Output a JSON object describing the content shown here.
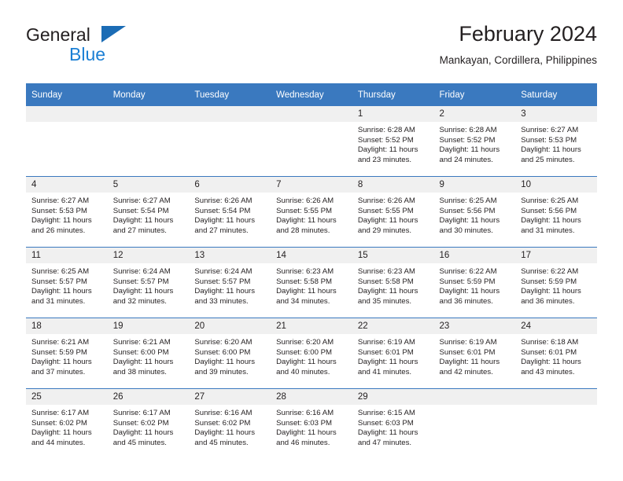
{
  "brand": {
    "name_top": "General",
    "name_bottom": "Blue",
    "triangle_color": "#1b6cb5",
    "blue_color": "#1b7fd4"
  },
  "header": {
    "title": "February 2024",
    "subtitle": "Mankayan, Cordillera, Philippines"
  },
  "theme": {
    "header_bg": "#3a79bf",
    "daynum_bg": "#f0f0f0",
    "row_divider": "#3a79bf",
    "text": "#231f20"
  },
  "weekday_headers": [
    "Sunday",
    "Monday",
    "Tuesday",
    "Wednesday",
    "Thursday",
    "Friday",
    "Saturday"
  ],
  "weeks": [
    [
      {
        "day": "",
        "sunrise": "",
        "sunset": "",
        "daylight_1": "",
        "daylight_2": ""
      },
      {
        "day": "",
        "sunrise": "",
        "sunset": "",
        "daylight_1": "",
        "daylight_2": ""
      },
      {
        "day": "",
        "sunrise": "",
        "sunset": "",
        "daylight_1": "",
        "daylight_2": ""
      },
      {
        "day": "",
        "sunrise": "",
        "sunset": "",
        "daylight_1": "",
        "daylight_2": ""
      },
      {
        "day": "1",
        "sunrise": "Sunrise: 6:28 AM",
        "sunset": "Sunset: 5:52 PM",
        "daylight_1": "Daylight: 11 hours",
        "daylight_2": "and 23 minutes."
      },
      {
        "day": "2",
        "sunrise": "Sunrise: 6:28 AM",
        "sunset": "Sunset: 5:52 PM",
        "daylight_1": "Daylight: 11 hours",
        "daylight_2": "and 24 minutes."
      },
      {
        "day": "3",
        "sunrise": "Sunrise: 6:27 AM",
        "sunset": "Sunset: 5:53 PM",
        "daylight_1": "Daylight: 11 hours",
        "daylight_2": "and 25 minutes."
      }
    ],
    [
      {
        "day": "4",
        "sunrise": "Sunrise: 6:27 AM",
        "sunset": "Sunset: 5:53 PM",
        "daylight_1": "Daylight: 11 hours",
        "daylight_2": "and 26 minutes."
      },
      {
        "day": "5",
        "sunrise": "Sunrise: 6:27 AM",
        "sunset": "Sunset: 5:54 PM",
        "daylight_1": "Daylight: 11 hours",
        "daylight_2": "and 27 minutes."
      },
      {
        "day": "6",
        "sunrise": "Sunrise: 6:26 AM",
        "sunset": "Sunset: 5:54 PM",
        "daylight_1": "Daylight: 11 hours",
        "daylight_2": "and 27 minutes."
      },
      {
        "day": "7",
        "sunrise": "Sunrise: 6:26 AM",
        "sunset": "Sunset: 5:55 PM",
        "daylight_1": "Daylight: 11 hours",
        "daylight_2": "and 28 minutes."
      },
      {
        "day": "8",
        "sunrise": "Sunrise: 6:26 AM",
        "sunset": "Sunset: 5:55 PM",
        "daylight_1": "Daylight: 11 hours",
        "daylight_2": "and 29 minutes."
      },
      {
        "day": "9",
        "sunrise": "Sunrise: 6:25 AM",
        "sunset": "Sunset: 5:56 PM",
        "daylight_1": "Daylight: 11 hours",
        "daylight_2": "and 30 minutes."
      },
      {
        "day": "10",
        "sunrise": "Sunrise: 6:25 AM",
        "sunset": "Sunset: 5:56 PM",
        "daylight_1": "Daylight: 11 hours",
        "daylight_2": "and 31 minutes."
      }
    ],
    [
      {
        "day": "11",
        "sunrise": "Sunrise: 6:25 AM",
        "sunset": "Sunset: 5:57 PM",
        "daylight_1": "Daylight: 11 hours",
        "daylight_2": "and 31 minutes."
      },
      {
        "day": "12",
        "sunrise": "Sunrise: 6:24 AM",
        "sunset": "Sunset: 5:57 PM",
        "daylight_1": "Daylight: 11 hours",
        "daylight_2": "and 32 minutes."
      },
      {
        "day": "13",
        "sunrise": "Sunrise: 6:24 AM",
        "sunset": "Sunset: 5:57 PM",
        "daylight_1": "Daylight: 11 hours",
        "daylight_2": "and 33 minutes."
      },
      {
        "day": "14",
        "sunrise": "Sunrise: 6:23 AM",
        "sunset": "Sunset: 5:58 PM",
        "daylight_1": "Daylight: 11 hours",
        "daylight_2": "and 34 minutes."
      },
      {
        "day": "15",
        "sunrise": "Sunrise: 6:23 AM",
        "sunset": "Sunset: 5:58 PM",
        "daylight_1": "Daylight: 11 hours",
        "daylight_2": "and 35 minutes."
      },
      {
        "day": "16",
        "sunrise": "Sunrise: 6:22 AM",
        "sunset": "Sunset: 5:59 PM",
        "daylight_1": "Daylight: 11 hours",
        "daylight_2": "and 36 minutes."
      },
      {
        "day": "17",
        "sunrise": "Sunrise: 6:22 AM",
        "sunset": "Sunset: 5:59 PM",
        "daylight_1": "Daylight: 11 hours",
        "daylight_2": "and 36 minutes."
      }
    ],
    [
      {
        "day": "18",
        "sunrise": "Sunrise: 6:21 AM",
        "sunset": "Sunset: 5:59 PM",
        "daylight_1": "Daylight: 11 hours",
        "daylight_2": "and 37 minutes."
      },
      {
        "day": "19",
        "sunrise": "Sunrise: 6:21 AM",
        "sunset": "Sunset: 6:00 PM",
        "daylight_1": "Daylight: 11 hours",
        "daylight_2": "and 38 minutes."
      },
      {
        "day": "20",
        "sunrise": "Sunrise: 6:20 AM",
        "sunset": "Sunset: 6:00 PM",
        "daylight_1": "Daylight: 11 hours",
        "daylight_2": "and 39 minutes."
      },
      {
        "day": "21",
        "sunrise": "Sunrise: 6:20 AM",
        "sunset": "Sunset: 6:00 PM",
        "daylight_1": "Daylight: 11 hours",
        "daylight_2": "and 40 minutes."
      },
      {
        "day": "22",
        "sunrise": "Sunrise: 6:19 AM",
        "sunset": "Sunset: 6:01 PM",
        "daylight_1": "Daylight: 11 hours",
        "daylight_2": "and 41 minutes."
      },
      {
        "day": "23",
        "sunrise": "Sunrise: 6:19 AM",
        "sunset": "Sunset: 6:01 PM",
        "daylight_1": "Daylight: 11 hours",
        "daylight_2": "and 42 minutes."
      },
      {
        "day": "24",
        "sunrise": "Sunrise: 6:18 AM",
        "sunset": "Sunset: 6:01 PM",
        "daylight_1": "Daylight: 11 hours",
        "daylight_2": "and 43 minutes."
      }
    ],
    [
      {
        "day": "25",
        "sunrise": "Sunrise: 6:17 AM",
        "sunset": "Sunset: 6:02 PM",
        "daylight_1": "Daylight: 11 hours",
        "daylight_2": "and 44 minutes."
      },
      {
        "day": "26",
        "sunrise": "Sunrise: 6:17 AM",
        "sunset": "Sunset: 6:02 PM",
        "daylight_1": "Daylight: 11 hours",
        "daylight_2": "and 45 minutes."
      },
      {
        "day": "27",
        "sunrise": "Sunrise: 6:16 AM",
        "sunset": "Sunset: 6:02 PM",
        "daylight_1": "Daylight: 11 hours",
        "daylight_2": "and 45 minutes."
      },
      {
        "day": "28",
        "sunrise": "Sunrise: 6:16 AM",
        "sunset": "Sunset: 6:03 PM",
        "daylight_1": "Daylight: 11 hours",
        "daylight_2": "and 46 minutes."
      },
      {
        "day": "29",
        "sunrise": "Sunrise: 6:15 AM",
        "sunset": "Sunset: 6:03 PM",
        "daylight_1": "Daylight: 11 hours",
        "daylight_2": "and 47 minutes."
      },
      {
        "day": "",
        "sunrise": "",
        "sunset": "",
        "daylight_1": "",
        "daylight_2": ""
      },
      {
        "day": "",
        "sunrise": "",
        "sunset": "",
        "daylight_1": "",
        "daylight_2": ""
      }
    ]
  ]
}
